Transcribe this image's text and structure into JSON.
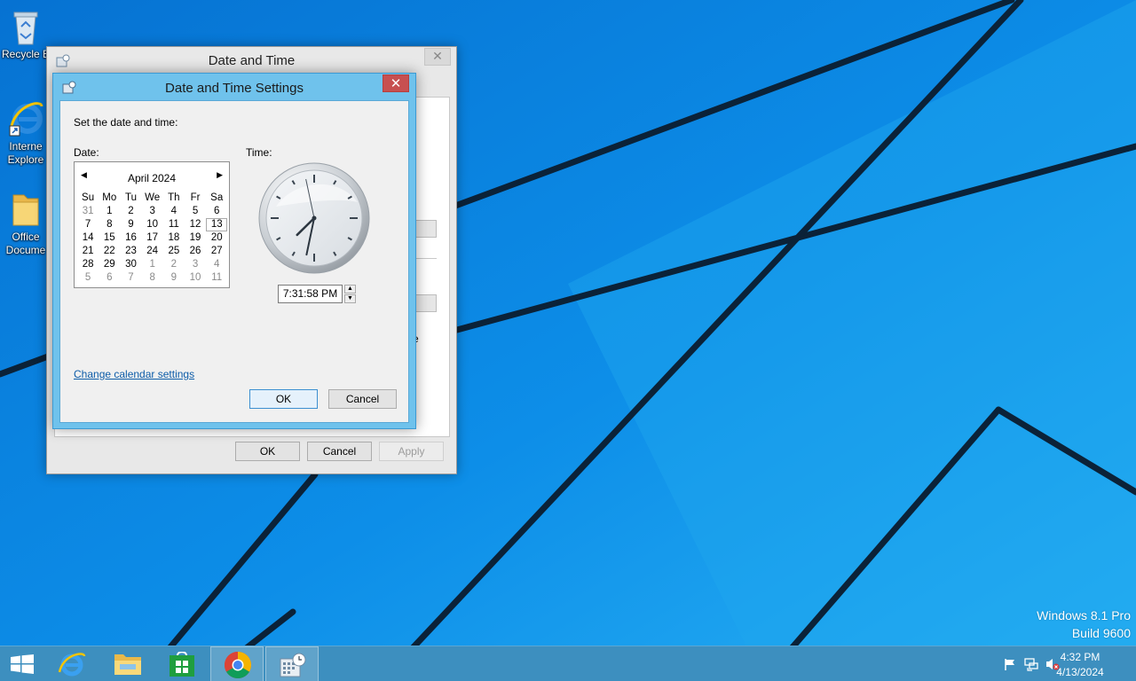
{
  "desktop": {
    "icons": [
      {
        "label": "Recycle Bin",
        "visible_label": "Recycle B"
      },
      {
        "label_line1": "Interne",
        "label_line2": "Explore"
      },
      {
        "label_line1": "Office",
        "label_line2": "Docume"
      }
    ],
    "watermark": {
      "line1": "Windows 8.1 Pro",
      "line2": "Build 9600"
    }
  },
  "outer_window": {
    "title": "Date and Time",
    "close_glyph": "✕",
    "partial_text": "e",
    "buttons": {
      "ok": "OK",
      "cancel": "Cancel",
      "apply": "Apply"
    }
  },
  "dialog": {
    "title": "Date and Time Settings",
    "close_glyph": "✕",
    "instruction": "Set the date and time:",
    "date_label": "Date:",
    "time_label": "Time:",
    "calendar": {
      "month_label": "April 2024",
      "prev_glyph": "◀",
      "next_glyph": "▶",
      "weekdays": [
        "Su",
        "Mo",
        "Tu",
        "We",
        "Th",
        "Fr",
        "Sa"
      ],
      "weeks": [
        [
          "31",
          "1",
          "2",
          "3",
          "4",
          "5",
          "6"
        ],
        [
          "7",
          "8",
          "9",
          "10",
          "11",
          "12",
          "13"
        ],
        [
          "14",
          "15",
          "16",
          "17",
          "18",
          "19",
          "20"
        ],
        [
          "21",
          "22",
          "23",
          "24",
          "25",
          "26",
          "27"
        ],
        [
          "28",
          "29",
          "30",
          "1",
          "2",
          "3",
          "4"
        ],
        [
          "5",
          "6",
          "7",
          "8",
          "9",
          "10",
          "11"
        ]
      ],
      "selected_day": "13"
    },
    "clock": {
      "hour": 7,
      "minute": 31,
      "second": 58
    },
    "time_value": "7:31:58 PM",
    "spin_up": "▲",
    "spin_down": "▼",
    "change_calendar_link": "Change calendar settings",
    "ok": "OK",
    "cancel": "Cancel"
  },
  "taskbar": {
    "clock_time": "4:32 PM",
    "clock_date": "4/13/2024"
  },
  "colors": {
    "desktop_blue": "#0a7ad8",
    "dialog_frame": "#6fc2ec",
    "close_red": "#c75050",
    "link_blue": "#0d5ca8"
  }
}
